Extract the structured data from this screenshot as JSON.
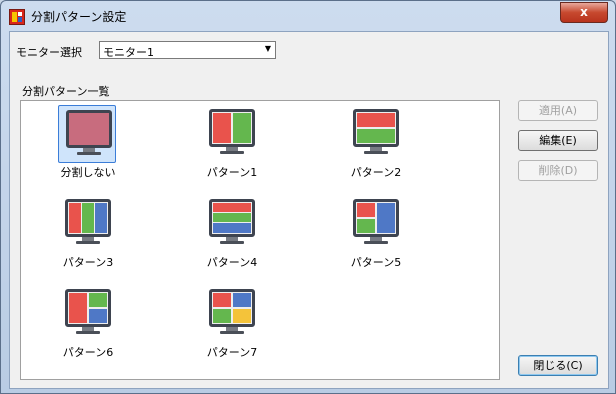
{
  "window": {
    "title": "分割パターン設定",
    "close_label": "x"
  },
  "monitor": {
    "label": "モニター選択",
    "selected": "モニター1"
  },
  "patterns": {
    "list_label": "分割パターン一覧",
    "items": [
      {
        "label": "分割しない"
      },
      {
        "label": "パターン1"
      },
      {
        "label": "パターン2"
      },
      {
        "label": "パターン3"
      },
      {
        "label": "パターン4"
      },
      {
        "label": "パターン5"
      },
      {
        "label": "パターン6"
      },
      {
        "label": "パターン7"
      }
    ]
  },
  "buttons": {
    "apply": "適用(A)",
    "edit": "編集(E)",
    "delete": "削除(D)",
    "close": "閉じる(C)"
  },
  "colors": {
    "red": "#e9534c",
    "green": "#64b74e",
    "blue": "#4f78c6",
    "yellow": "#f4c33a",
    "unsplit": "#c86c7e"
  }
}
